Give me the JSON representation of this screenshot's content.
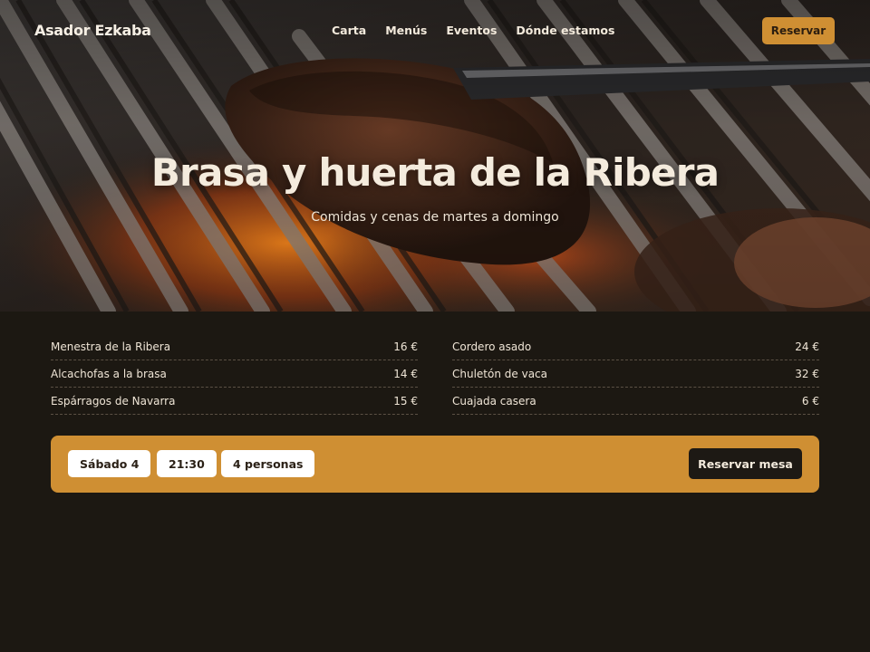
{
  "brand": "Asador Ezkaba",
  "nav": {
    "links": [
      "Carta",
      "Menús",
      "Eventos",
      "Dónde estamos"
    ],
    "cta": "Reservar"
  },
  "hero": {
    "title": "Brasa y huerta de la Ribera",
    "subtitle": "Comidas y cenas de martes a domingo"
  },
  "menu": {
    "left": [
      {
        "name": "Menestra de la Ribera",
        "price": "16 €"
      },
      {
        "name": "Alcachofas a la brasa",
        "price": "14 €"
      },
      {
        "name": "Espárragos de Navarra",
        "price": "15 €"
      }
    ],
    "right": [
      {
        "name": "Cordero asado",
        "price": "24 €"
      },
      {
        "name": "Chuletón de vaca",
        "price": "32 €"
      },
      {
        "name": "Cuajada casera",
        "price": "6 €"
      }
    ]
  },
  "booking": {
    "date": "Sábado 4",
    "time": "21:30",
    "party": "4 personas",
    "submit": "Reservar mesa"
  },
  "colors": {
    "accent": "#cf8f33",
    "background": "#1c1812",
    "text": "#f1e6d4"
  }
}
